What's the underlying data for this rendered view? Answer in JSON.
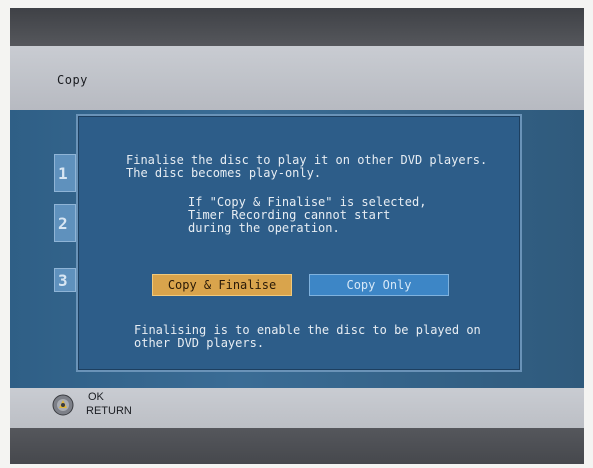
{
  "header": {
    "title": "Copy"
  },
  "side_tabs": [
    "1",
    "2",
    "3"
  ],
  "dialog": {
    "main_lines": [
      "Finalise the disc to play it on other DVD players.",
      "The disc becomes play-only."
    ],
    "note_lines": [
      "If \"Copy & Finalise\" is selected,",
      "Timer Recording cannot start",
      "during the operation."
    ],
    "buttons": {
      "copy_finalise": "Copy & Finalise",
      "copy_only": "Copy Only"
    },
    "footer_lines": [
      "Finalising is to enable the disc to be played on",
      "other DVD players."
    ]
  },
  "controls": {
    "ok_label": "OK",
    "return_label": "RETURN",
    "icon": "disc-remote-icon"
  },
  "colors": {
    "selected_button": "#d9a44c",
    "unselected_button": "#3d86c6",
    "dialog_bg": "#2d5d89"
  }
}
